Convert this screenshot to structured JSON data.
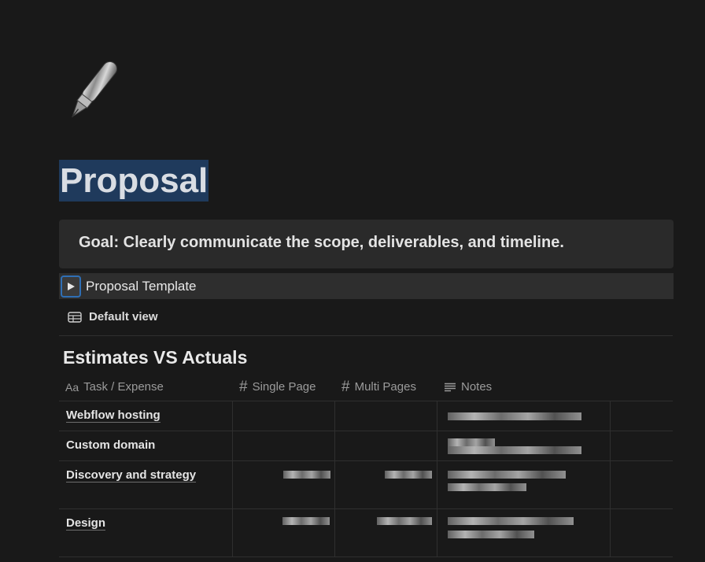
{
  "page": {
    "title": "Proposal",
    "icon": "fountain-pen-icon"
  },
  "callout": {
    "text": "Goal: Clearly communicate the scope, deliverables, and timeline."
  },
  "toggle": {
    "label": "Proposal Template"
  },
  "view": {
    "label": "Default view",
    "icon": "table-icon"
  },
  "database": {
    "title": "Estimates VS Actuals",
    "columns": [
      {
        "label": "Task / Expense",
        "icon": "Aa"
      },
      {
        "label": "Single Page",
        "icon": "#"
      },
      {
        "label": "Multi Pages",
        "icon": "#"
      },
      {
        "label": "Notes",
        "icon": "text-lines-icon"
      }
    ],
    "rows": [
      {
        "name": "Webflow hosting"
      },
      {
        "name": "Custom domain"
      },
      {
        "name": "Discovery and strategy"
      },
      {
        "name": "Design"
      }
    ]
  },
  "colors": {
    "background": "#191919",
    "title_highlight": "#1f3a5c",
    "callout_bg": "#2a2a2a",
    "toggle_focus": "#2f6fb5"
  }
}
